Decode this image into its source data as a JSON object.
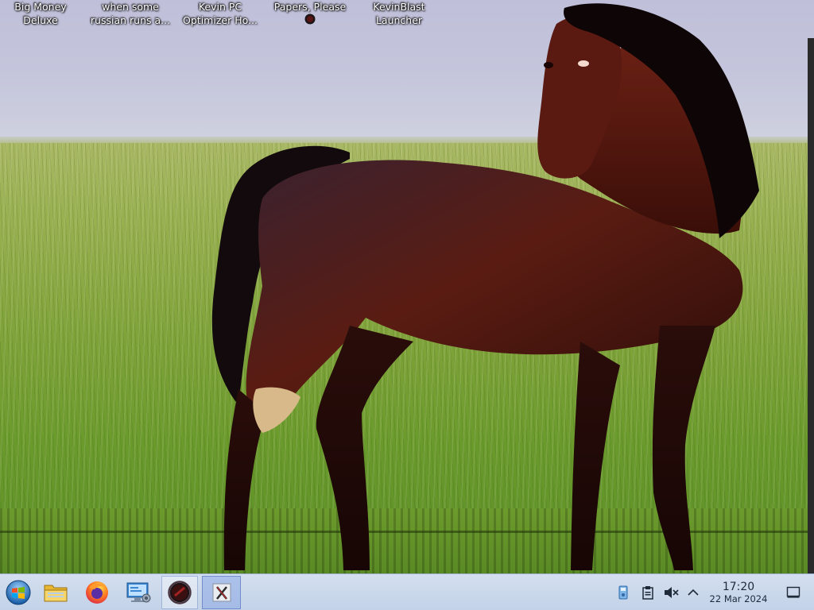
{
  "desktop": {
    "icons": [
      {
        "label": "Big Money\nDeluxe"
      },
      {
        "label": "when some\nrussian runs a..."
      },
      {
        "label": "Kevin PC\nOptimizer Ho..."
      },
      {
        "label": "Papers, Please"
      },
      {
        "label": "KevinBlast\nLauncher"
      }
    ]
  },
  "taskbar": {
    "start": {
      "icon": "windows-orb-icon"
    },
    "pinned": [
      {
        "icon": "file-explorer-icon"
      },
      {
        "icon": "firefox-icon"
      },
      {
        "icon": "network-settings-icon"
      },
      {
        "icon": "papers-please-icon"
      },
      {
        "icon": "kevin-x-app-icon"
      }
    ],
    "tray": [
      {
        "icon": "usb-device-icon"
      },
      {
        "icon": "clipboard-icon"
      },
      {
        "icon": "speaker-muted-icon"
      },
      {
        "icon": "chevron-up-icon"
      }
    ],
    "clock": {
      "time": "17:20",
      "date": "22 Mar 2024"
    },
    "show_desktop": {
      "icon": "show-desktop-icon"
    }
  },
  "colors": {
    "taskbar": "#c8d6ea",
    "clock_text": "#1c2a3d"
  }
}
